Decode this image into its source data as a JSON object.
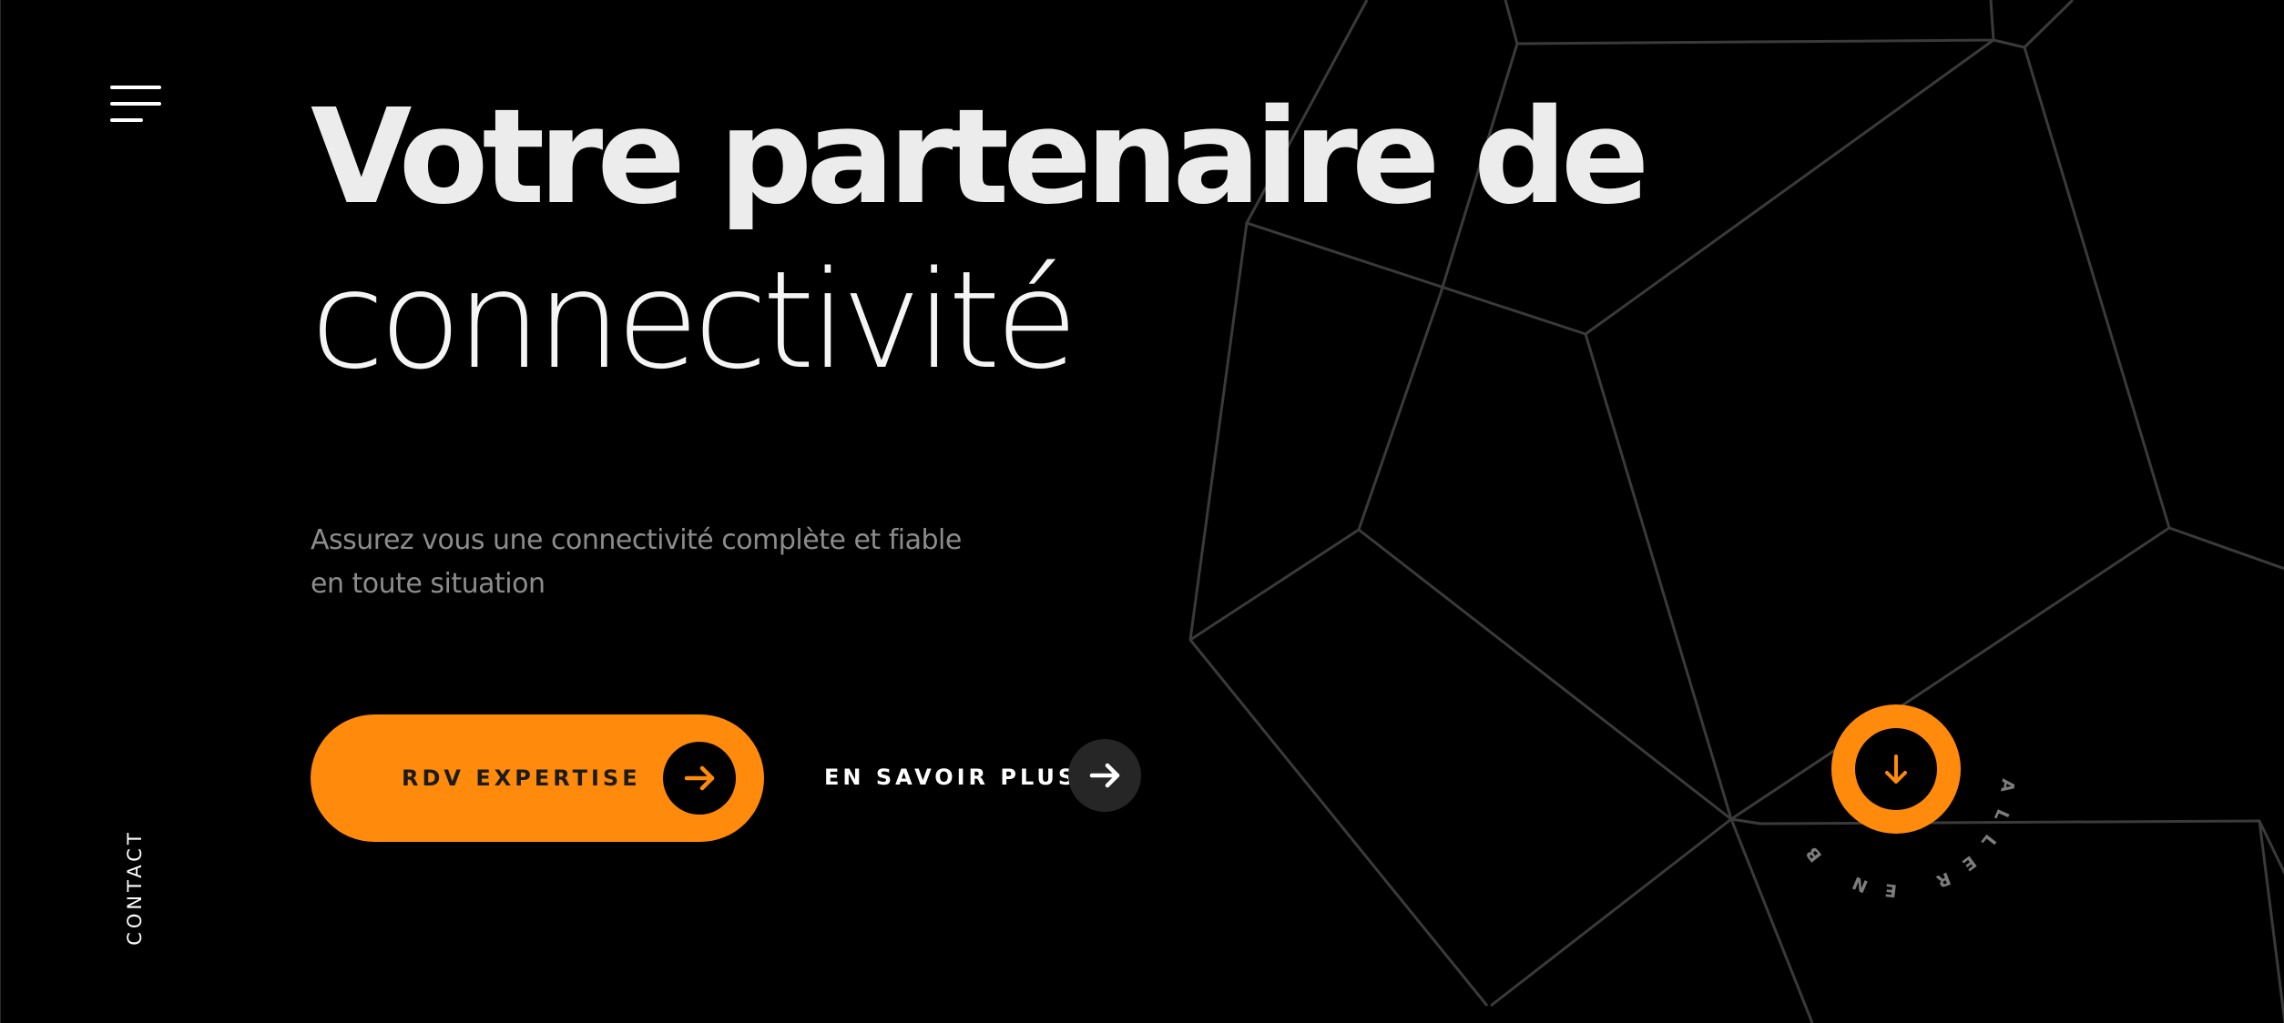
{
  "nav": {
    "menu_icon": "hamburger-menu-icon",
    "contact_label": "CONTACT"
  },
  "hero": {
    "title_bold": "Votre partenaire de",
    "title_light": "connectivité",
    "subtitle": "Assurez vous une connectivité complète et fiable en toute situation"
  },
  "actions": {
    "primary_label": "RDV EXPERTISE",
    "primary_icon": "arrow-right-icon",
    "secondary_label": "EN SAVOIR PLUS",
    "secondary_icon": "arrow-right-icon"
  },
  "scroll": {
    "label": "ALLER EN BAS",
    "icon": "arrow-down-icon"
  },
  "colors": {
    "background": "#000000",
    "accent": "#ff8a0b",
    "title": "#ececec",
    "subtitle": "#8c8c8c",
    "lines": "#3a3a3a"
  }
}
